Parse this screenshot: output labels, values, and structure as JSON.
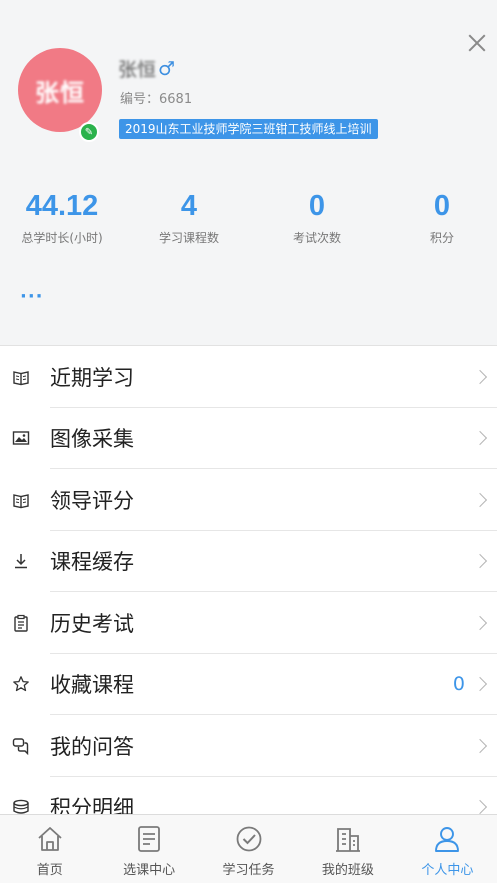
{
  "profile": {
    "avatar_text": "张恒",
    "name": "张恒",
    "gender_symbol": "♂",
    "id_label": "编号：6681",
    "class_tag": "2019山东工业技师学院三班钳工技师线上培训"
  },
  "stats": [
    {
      "value": "44.12",
      "label": "总学时长(小时)"
    },
    {
      "value": "4",
      "label": "学习课程数"
    },
    {
      "value": "0",
      "label": "考试次数"
    },
    {
      "value": "0",
      "label": "积分"
    }
  ],
  "more_dots": "···",
  "menu": [
    {
      "label": "近期学习",
      "icon": "book-icon"
    },
    {
      "label": "图像采集",
      "icon": "image-icon"
    },
    {
      "label": "领导评分",
      "icon": "book-icon"
    },
    {
      "label": "课程缓存",
      "icon": "download-icon"
    },
    {
      "label": "历史考试",
      "icon": "clipboard-icon"
    },
    {
      "label": "收藏课程",
      "icon": "star-icon",
      "count": "0"
    },
    {
      "label": "我的问答",
      "icon": "chat-icon"
    },
    {
      "label": "积分明细",
      "icon": "coins-icon"
    }
  ],
  "tabs": [
    {
      "label": "首页",
      "icon": "home-icon"
    },
    {
      "label": "选课中心",
      "icon": "list-icon"
    },
    {
      "label": "学习任务",
      "icon": "check-circle-icon"
    },
    {
      "label": "我的班级",
      "icon": "building-icon"
    },
    {
      "label": "个人中心",
      "icon": "user-icon",
      "active": true
    }
  ],
  "colors": {
    "accent": "#3d95e8",
    "avatar_bg": "#f17a85",
    "edit_badge": "#2bb24c",
    "background": "#f4f5f6"
  }
}
